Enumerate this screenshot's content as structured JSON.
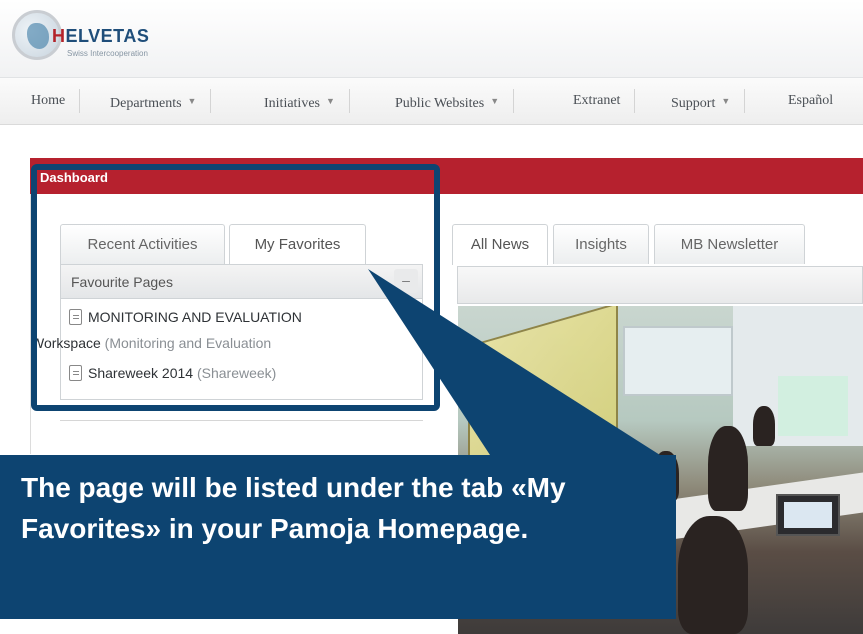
{
  "header": {
    "logo_text": "HELVETAS",
    "logo_subtitle": "Swiss Intercooperation"
  },
  "nav": {
    "items": [
      {
        "label": "Home",
        "dropdown": false
      },
      {
        "label": "Departments",
        "dropdown": true
      },
      {
        "label": "Initiatives",
        "dropdown": true
      },
      {
        "label": "Public Websites",
        "dropdown": true
      },
      {
        "label": "Extranet",
        "dropdown": false
      },
      {
        "label": "Support",
        "dropdown": true
      },
      {
        "label": "Español",
        "dropdown": false
      }
    ],
    "caret_glyph": "▼"
  },
  "dashboard": {
    "title": "Dashboard",
    "left_tabs": [
      "Recent Activities",
      "My Favorites"
    ],
    "active_left_tab": "My Favorites",
    "favourites": {
      "header": "Favourite Pages",
      "collapse_glyph": "–",
      "items": [
        {
          "title_line1": "MONITORING AND EVALUATION",
          "title_line2": "Workspace",
          "context": "(Monitoring and Evaluation"
        },
        {
          "title_line1": "Shareweek 2014",
          "context": "(Shareweek)"
        }
      ]
    },
    "right_tabs": [
      "All News",
      "Insights",
      "MB Newsletter"
    ],
    "active_right_tab": "All News"
  },
  "callout": {
    "text": "The page will be listed under the tab «My Favorites» in your Pamoja Homepage.",
    "color": "#0d4471"
  },
  "colors": {
    "accent_red": "#b6212e",
    "highlight_blue": "#0d4471"
  }
}
